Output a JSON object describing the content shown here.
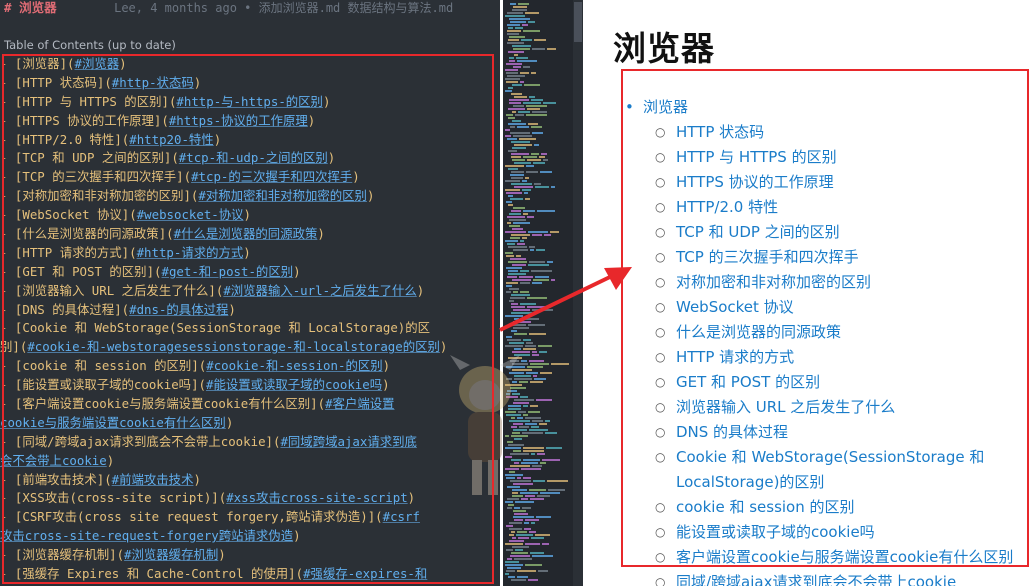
{
  "editor": {
    "header_hash": "#",
    "header_title": "浏览器",
    "blame": "Lee, 4 months ago • 添加浏览器.md 数据结构与算法.md",
    "toc_note": "Table of Contents (up to date)",
    "lines": [
      [
        [
          "d",
          "- "
        ],
        [
          "b",
          "["
        ],
        [
          "t",
          "浏览器"
        ],
        [
          "b",
          "]("
        ],
        [
          "a",
          "#浏览器"
        ],
        [
          "b",
          ")"
        ]
      ],
      [
        [
          "d",
          "  - "
        ],
        [
          "b",
          "["
        ],
        [
          "t",
          "HTTP 状态码"
        ],
        [
          "b",
          "]("
        ],
        [
          "a",
          "#http-状态码"
        ],
        [
          "b",
          ")"
        ]
      ],
      [
        [
          "d",
          "  - "
        ],
        [
          "b",
          "["
        ],
        [
          "t",
          "HTTP 与 HTTPS 的区别"
        ],
        [
          "b",
          "]("
        ],
        [
          "a",
          "#http-与-https-的区别"
        ],
        [
          "b",
          ")"
        ]
      ],
      [
        [
          "d",
          "  - "
        ],
        [
          "b",
          "["
        ],
        [
          "t",
          "HTTPS 协议的工作原理"
        ],
        [
          "b",
          "]("
        ],
        [
          "a",
          "#https-协议的工作原理"
        ],
        [
          "b",
          ")"
        ]
      ],
      [
        [
          "d",
          "  - "
        ],
        [
          "b",
          "["
        ],
        [
          "t",
          "HTTP/2.0 特性"
        ],
        [
          "b",
          "]("
        ],
        [
          "a",
          "#http20-特性"
        ],
        [
          "b",
          ")"
        ]
      ],
      [
        [
          "d",
          "  - "
        ],
        [
          "b",
          "["
        ],
        [
          "t",
          "TCP 和 UDP 之间的区别"
        ],
        [
          "b",
          "]("
        ],
        [
          "a",
          "#tcp-和-udp-之间的区别"
        ],
        [
          "b",
          ")"
        ]
      ],
      [
        [
          "d",
          "  - "
        ],
        [
          "b",
          "["
        ],
        [
          "t",
          "TCP 的三次握手和四次挥手"
        ],
        [
          "b",
          "]("
        ],
        [
          "a",
          "#tcp-的三次握手和四次挥手"
        ],
        [
          "b",
          ")"
        ]
      ],
      [
        [
          "d",
          "  - "
        ],
        [
          "b",
          "["
        ],
        [
          "t",
          "对称加密和非对称加密的区别"
        ],
        [
          "b",
          "]("
        ],
        [
          "a",
          "#对称加密和非对称加密的区别"
        ],
        [
          "b",
          ")"
        ]
      ],
      [
        [
          "d",
          "  - "
        ],
        [
          "b",
          "["
        ],
        [
          "t",
          "WebSocket 协议"
        ],
        [
          "b",
          "]("
        ],
        [
          "a",
          "#websocket-协议"
        ],
        [
          "b",
          ")"
        ]
      ],
      [
        [
          "d",
          "  - "
        ],
        [
          "b",
          "["
        ],
        [
          "t",
          "什么是浏览器的同源政策"
        ],
        [
          "b",
          "]("
        ],
        [
          "a",
          "#什么是浏览器的同源政策"
        ],
        [
          "b",
          ")"
        ]
      ],
      [
        [
          "d",
          "  - "
        ],
        [
          "b",
          "["
        ],
        [
          "t",
          "HTTP 请求的方式"
        ],
        [
          "b",
          "]("
        ],
        [
          "a",
          "#http-请求的方式"
        ],
        [
          "b",
          ")"
        ]
      ],
      [
        [
          "d",
          "  - "
        ],
        [
          "b",
          "["
        ],
        [
          "t",
          "GET 和 POST 的区别"
        ],
        [
          "b",
          "]("
        ],
        [
          "a",
          "#get-和-post-的区别"
        ],
        [
          "b",
          ")"
        ]
      ],
      [
        [
          "d",
          "  - "
        ],
        [
          "b",
          "["
        ],
        [
          "t",
          "浏览器输入 URL 之后发生了什么"
        ],
        [
          "b",
          "]("
        ],
        [
          "a",
          "#浏览器输入-url-之后发生了什么"
        ],
        [
          "b",
          ")"
        ]
      ],
      [
        [
          "d",
          "  - "
        ],
        [
          "b",
          "["
        ],
        [
          "t",
          "DNS 的具体过程"
        ],
        [
          "b",
          "]("
        ],
        [
          "a",
          "#dns-的具体过程"
        ],
        [
          "b",
          ")"
        ]
      ],
      [
        [
          "d",
          "  - "
        ],
        [
          "b",
          "["
        ],
        [
          "t",
          "Cookie 和 WebStorage(SessionStorage 和 LocalStorage)的区"
        ]
      ],
      [
        [
          "t",
          "别"
        ],
        [
          "b",
          "]("
        ],
        [
          "a",
          "#cookie-和-webstoragesessionstorage-和-localstorage的区别"
        ],
        [
          "b",
          ")"
        ]
      ],
      [
        [
          "d",
          "  - "
        ],
        [
          "b",
          "["
        ],
        [
          "t",
          "cookie 和 session 的区别"
        ],
        [
          "b",
          "]("
        ],
        [
          "a",
          "#cookie-和-session-的区别"
        ],
        [
          "b",
          ")"
        ]
      ],
      [
        [
          "d",
          "  - "
        ],
        [
          "b",
          "["
        ],
        [
          "t",
          "能设置或读取子域的cookie吗"
        ],
        [
          "b",
          "]("
        ],
        [
          "a",
          "#能设置或读取子域的cookie吗"
        ],
        [
          "b",
          ")"
        ]
      ],
      [
        [
          "d",
          "  - "
        ],
        [
          "b",
          "["
        ],
        [
          "t",
          "客户端设置cookie与服务端设置cookie有什么区别"
        ],
        [
          "b",
          "]("
        ],
        [
          "a",
          "#客户端设置"
        ]
      ],
      [
        [
          "a",
          "cookie与服务端设置cookie有什么区别"
        ],
        [
          "b",
          ")"
        ]
      ],
      [
        [
          "d",
          "  - "
        ],
        [
          "b",
          "["
        ],
        [
          "t",
          "同域/跨域ajax请求到底会不会带上cookie"
        ],
        [
          "b",
          "]("
        ],
        [
          "a",
          "#同域跨域ajax请求到底"
        ]
      ],
      [
        [
          "a",
          "会不会带上cookie"
        ],
        [
          "b",
          ")"
        ]
      ],
      [
        [
          "d",
          "  - "
        ],
        [
          "b",
          "["
        ],
        [
          "t",
          "前端攻击技术"
        ],
        [
          "b",
          "]("
        ],
        [
          "a",
          "#前端攻击技术"
        ],
        [
          "b",
          ")"
        ]
      ],
      [
        [
          "d",
          "    - "
        ],
        [
          "b",
          "["
        ],
        [
          "t",
          "XSS攻击(cross-site script)"
        ],
        [
          "b",
          "]("
        ],
        [
          "a",
          "#xss攻击cross-site-script"
        ],
        [
          "b",
          ")"
        ]
      ],
      [
        [
          "d",
          "    - "
        ],
        [
          "b",
          "["
        ],
        [
          "t",
          "CSRF攻击(cross site request forgery,跨站请求伪造)"
        ],
        [
          "b",
          "]("
        ],
        [
          "a",
          "#csrf"
        ]
      ],
      [
        [
          "a",
          "  攻击cross-site-request-forgery跨站请求伪造"
        ],
        [
          "b",
          ")"
        ]
      ],
      [
        [
          "d",
          "  - "
        ],
        [
          "b",
          "["
        ],
        [
          "t",
          "浏览器缓存机制"
        ],
        [
          "b",
          "]("
        ],
        [
          "a",
          "#浏览器缓存机制"
        ],
        [
          "b",
          ")"
        ]
      ],
      [
        [
          "d",
          "  - "
        ],
        [
          "b",
          "["
        ],
        [
          "t",
          "强缓存 Expires 和 Cache-Control 的使用"
        ],
        [
          "b",
          "]("
        ],
        [
          "a",
          "#强缓存-expires-和"
        ]
      ]
    ]
  },
  "preview": {
    "title": "浏览器",
    "items": [
      {
        "level": 1,
        "text": "浏览器"
      },
      {
        "level": 2,
        "text": "HTTP 状态码"
      },
      {
        "level": 2,
        "text": "HTTP 与 HTTPS 的区别"
      },
      {
        "level": 2,
        "text": "HTTPS 协议的工作原理"
      },
      {
        "level": 2,
        "text": "HTTP/2.0 特性"
      },
      {
        "level": 2,
        "text": "TCP 和 UDP 之间的区别"
      },
      {
        "level": 2,
        "text": "TCP 的三次握手和四次挥手"
      },
      {
        "level": 2,
        "text": "对称加密和非对称加密的区别"
      },
      {
        "level": 2,
        "text": "WebSocket 协议"
      },
      {
        "level": 2,
        "text": "什么是浏览器的同源政策"
      },
      {
        "level": 2,
        "text": "HTTP 请求的方式"
      },
      {
        "level": 2,
        "text": "GET 和 POST 的区别"
      },
      {
        "level": 2,
        "text": "浏览器输入 URL 之后发生了什么"
      },
      {
        "level": 2,
        "text": "DNS 的具体过程"
      },
      {
        "level": 2,
        "text": "Cookie 和 WebStorage(SessionStorage 和"
      },
      {
        "level": "cont",
        "text": "LocalStorage)的区别"
      },
      {
        "level": 2,
        "text": "cookie 和 session 的区别"
      },
      {
        "level": 2,
        "text": "能设置或读取子域的cookie吗"
      },
      {
        "level": 2,
        "text": "客户端设置cookie与服务端设置cookie有什么区别"
      },
      {
        "level": 2,
        "text": "同域/跨域ajax请求到底会不会带上cookie"
      }
    ]
  },
  "colors": {
    "annotation": "#e8282b",
    "link": "#1a7cc9",
    "editor_bg": "#2b3036"
  }
}
